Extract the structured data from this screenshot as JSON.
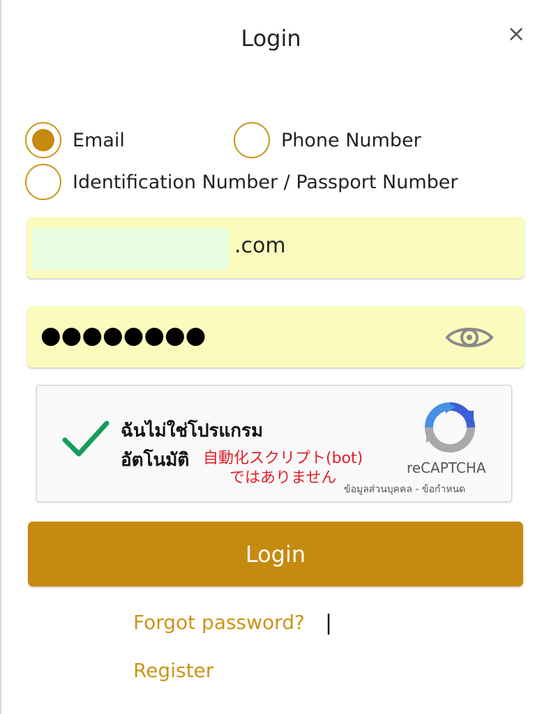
{
  "header": {
    "title": "Login",
    "close_symbol": "×"
  },
  "login_type": {
    "options": [
      {
        "label": "Email",
        "selected": true
      },
      {
        "label": "Phone Number",
        "selected": false
      },
      {
        "label": "Identification Number / Passport Number",
        "selected": false
      }
    ]
  },
  "email_field": {
    "value_visible": ".com"
  },
  "password_field": {
    "masked_value": "●●●●●●●●",
    "icon": "eye-icon"
  },
  "recaptcha": {
    "line1": "ฉันไม่ใช่โปรแกรม",
    "line2": "อัตโนมัติ",
    "jp_line1": "自動化スクリプト(bot)",
    "jp_line2": "ではありません",
    "brand": "reCAPTCHA",
    "links": "ข้อมูลส่วนบุคคล - ข้อกำหนด",
    "checked": true
  },
  "actions": {
    "login_label": "Login",
    "forgot_password": "Forgot password?",
    "separator": "|",
    "register": "Register"
  },
  "colors": {
    "accent": "#c68a10",
    "field_bg": "#fafbbd",
    "check_green": "#169c5a",
    "japanese_red": "#e0202a"
  }
}
